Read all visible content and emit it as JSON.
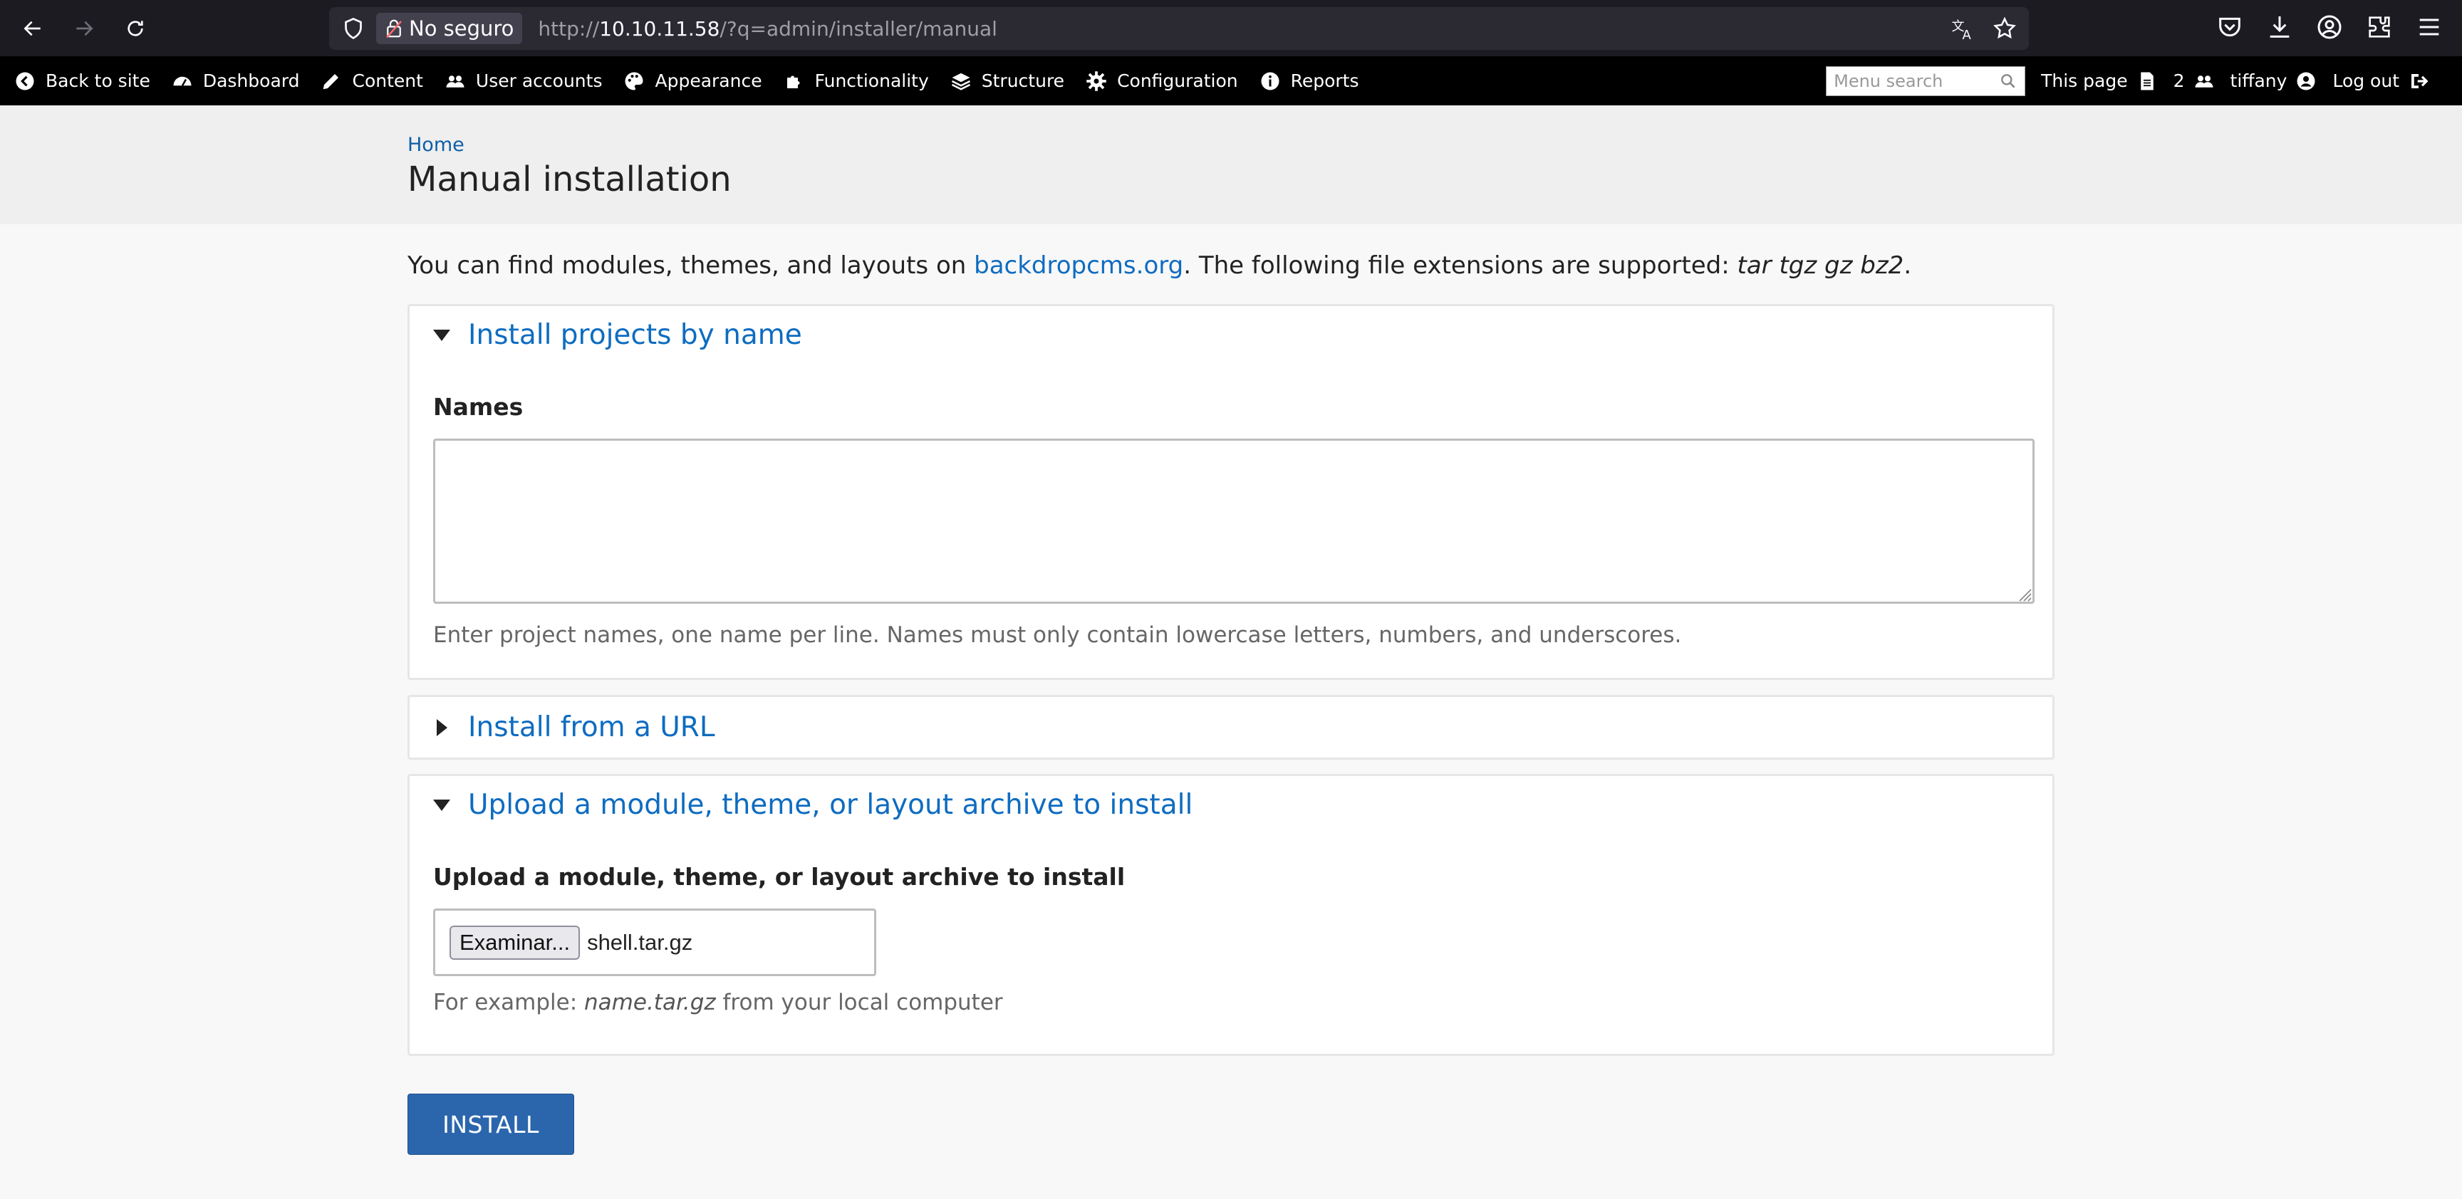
{
  "browser": {
    "security_label": "No seguro",
    "url_prefix": "http://",
    "url_host": "10.10.11.58",
    "url_path": "/?q=admin/installer/manual"
  },
  "admin_bar": {
    "items": [
      {
        "label": "Back to site",
        "icon": "back-arrow-circle-icon"
      },
      {
        "label": "Dashboard",
        "icon": "gauge-icon"
      },
      {
        "label": "Content",
        "icon": "pencil-icon"
      },
      {
        "label": "User accounts",
        "icon": "users-icon"
      },
      {
        "label": "Appearance",
        "icon": "palette-icon"
      },
      {
        "label": "Functionality",
        "icon": "puzzle-icon"
      },
      {
        "label": "Structure",
        "icon": "layers-icon"
      },
      {
        "label": "Configuration",
        "icon": "gear-icon"
      },
      {
        "label": "Reports",
        "icon": "info-icon"
      }
    ],
    "menu_search_placeholder": "Menu search",
    "this_page": "This page",
    "users_count": "2",
    "username": "tiffany",
    "logout": "Log out"
  },
  "header": {
    "breadcrumb": "Home",
    "title": "Manual installation"
  },
  "intro": {
    "prefix": "You can find modules, themes, and layouts on ",
    "link": "backdropcms.org",
    "middle": ". The following file extensions are supported: ",
    "extensions": "tar tgz gz bz2",
    "suffix": "."
  },
  "fieldsets": {
    "by_name": {
      "legend": "Install projects by name",
      "label": "Names",
      "value": "",
      "description": "Enter project names, one name per line. Names must only contain lowercase letters, numbers, and underscores."
    },
    "from_url": {
      "legend": "Install from a URL"
    },
    "upload": {
      "legend": "Upload a module, theme, or layout archive to install",
      "label": "Upload a module, theme, or layout archive to install",
      "browse_button": "Examinar...",
      "file_name": "shell.tar.gz",
      "desc_prefix": "For example: ",
      "desc_example": "name.tar.gz",
      "desc_suffix": " from your local computer"
    }
  },
  "install_button": "INSTALL"
}
